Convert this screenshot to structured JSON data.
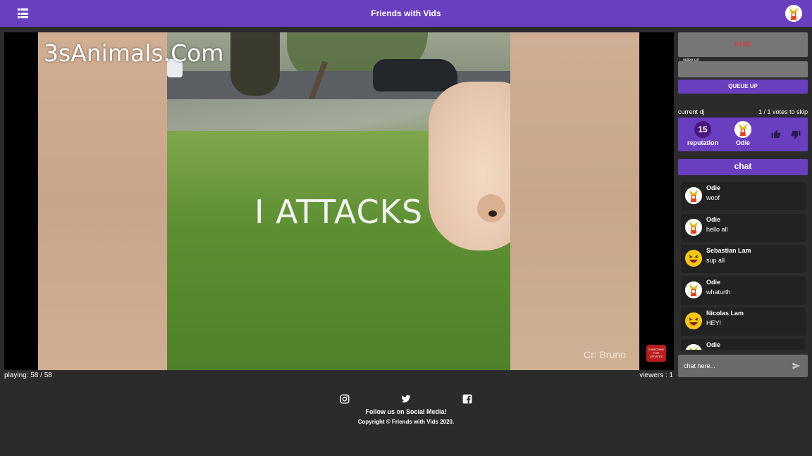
{
  "header": {
    "title": "Friends with Vids",
    "menu_icon": "list-menu-icon",
    "avatar_icon": "odie-avatar-icon"
  },
  "video": {
    "watermark": "3sAnimals.Com",
    "caption": "I ATTACKS",
    "credit": "Cr: Bruno",
    "subscribe_badge": "SUBSCRIBE FOR UPDATES"
  },
  "status": {
    "playing": "playing: 58 / 58",
    "viewers": "viewers : 1"
  },
  "sidebar": {
    "sync_label": "SYNC",
    "url_label": "video url",
    "url_value": "",
    "queue_label": "QUEUE UP",
    "current_dj_label": "current dj",
    "votes_label": "1 / 1 votes to skip",
    "reputation_value": "15",
    "reputation_label": "reputation",
    "dj_name": "Odie",
    "chat_label": "chat",
    "chat_placeholder": "chat here..."
  },
  "chat": {
    "messages": [
      {
        "name": "Odie",
        "text": "woof",
        "avatar": "odie-avatar-icon"
      },
      {
        "name": "Odie",
        "text": "hello all",
        "avatar": "odie-avatar-icon"
      },
      {
        "name": "Sebastian Lam",
        "text": "sup all",
        "avatar": "laughing-emoji-icon"
      },
      {
        "name": "Odie",
        "text": "whaturth",
        "avatar": "odie-avatar-icon"
      },
      {
        "name": "Nicolas Lam",
        "text": "HEY!",
        "avatar": "laughing-emoji-icon"
      },
      {
        "name": "Odie",
        "text": "",
        "avatar": "odie-avatar-icon"
      }
    ]
  },
  "footer": {
    "follow": "Follow us on Social Media!",
    "copyright": "Copyright © Friends with Vids 2020.",
    "icons": [
      "instagram-icon",
      "twitter-icon",
      "facebook-icon"
    ]
  },
  "colors": {
    "accent": "#6a3fbf",
    "background": "#2b2b2b",
    "sync_text": "#e53935"
  }
}
